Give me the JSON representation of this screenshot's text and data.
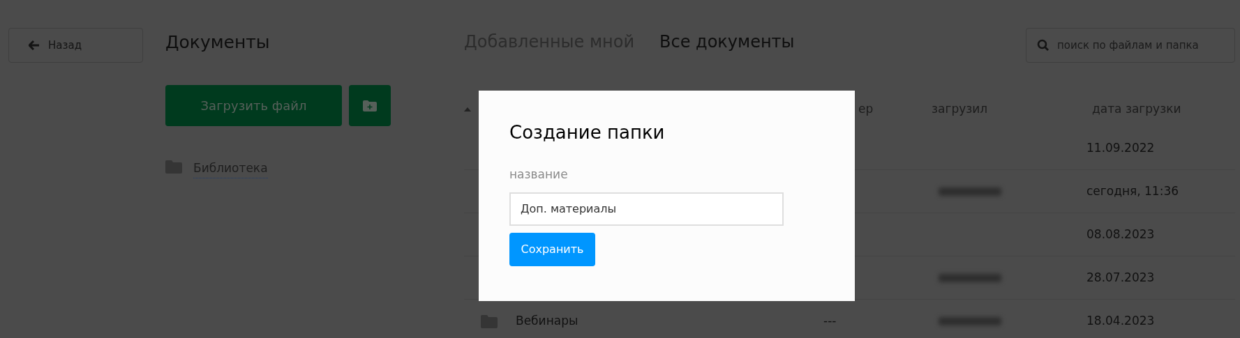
{
  "back_button": {
    "label": "Назад"
  },
  "sidebar": {
    "title": "Документы",
    "upload_button": {
      "label": "Загрузить файл"
    },
    "items": [
      {
        "label": "Библиотека"
      }
    ]
  },
  "tabs": [
    {
      "label": "Добавленные мной",
      "selected": false
    },
    {
      "label": "Все документы",
      "selected": true
    }
  ],
  "search": {
    "placeholder": "поиск по файлам и папка"
  },
  "table": {
    "columns": [
      {
        "sorted": true
      },
      {
        "label": "ер",
        "sorted": false
      },
      {
        "label": "загрузил",
        "sorted": false
      },
      {
        "label": "дата загрузки",
        "sorted": false
      }
    ],
    "rows": [
      {
        "uploader_blurred": false,
        "date": "11.09.2022"
      },
      {
        "uploader_blurred": true,
        "date": "сегодня, 11:36"
      },
      {
        "uploader_blurred": false,
        "date": "08.08.2023"
      },
      {
        "uploader_blurred": true,
        "date": "28.07.2023"
      },
      {
        "name": "Вебинары",
        "size": "---",
        "uploader_blurred": true,
        "date": "18.04.2023"
      }
    ]
  },
  "dialog": {
    "title": "Создание папки",
    "field_label": "название",
    "field_value": "Доп. материалы",
    "save_button": {
      "label": "Сохранить"
    }
  }
}
